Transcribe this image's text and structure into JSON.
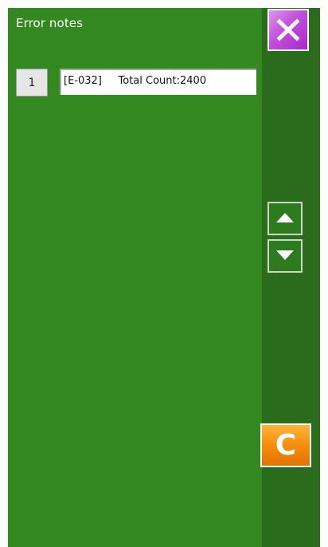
{
  "header": {
    "title": "Error notes"
  },
  "list": {
    "items": [
      {
        "number": "1",
        "text": "[E-032]     Total Count:2400"
      }
    ]
  },
  "buttons": {
    "clear_label": "C"
  },
  "icons": {
    "close": "close-icon",
    "up": "arrow-up-icon",
    "down": "arrow-down-icon"
  },
  "colors": {
    "background": "#33881f",
    "side_panel": "#2a6b1c",
    "close_button": "#c24fdc",
    "clear_button": "#f38b0a"
  }
}
